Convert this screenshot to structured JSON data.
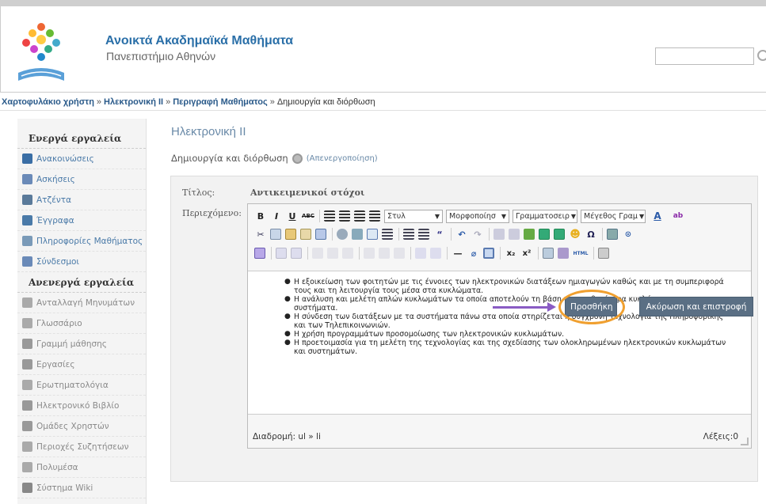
{
  "header": {
    "site_title": "Ανοικτά Ακαδημαϊκά Μαθήματα",
    "site_subtitle": "Πανεπιστήμιο Αθηνών",
    "search_placeholder": ""
  },
  "breadcrumb": {
    "items": [
      "Χαρτοφυλάκιο χρήστη",
      "Ηλεκτρονική ΙΙ",
      "Περιγραφή Μαθήματος"
    ],
    "current": "Δημιουργία και διόρθωση",
    "separator": "»"
  },
  "sidebar": {
    "active_heading": "Ενεργά εργαλεία",
    "active_items": [
      {
        "label": "Ανακοινώσεις",
        "icon": "announcement-icon",
        "color": "#3a6ea5"
      },
      {
        "label": "Ασκήσεις",
        "icon": "exercise-icon",
        "color": "#6a8ab8"
      },
      {
        "label": "Ατζέντα",
        "icon": "calendar-icon",
        "color": "#5a7a9a"
      },
      {
        "label": "Έγγραφα",
        "icon": "folder-icon",
        "color": "#4a7aa8"
      },
      {
        "label": "Πληροφορίες Μαθήματος",
        "icon": "info-icon",
        "color": "#7a9ab8"
      },
      {
        "label": "Σύνδεσμοι",
        "icon": "link-icon",
        "color": "#6a8ab8"
      }
    ],
    "inactive_heading": "Ανενεργά εργαλεία",
    "inactive_items": [
      {
        "label": "Ανταλλαγή Μηνυμάτων",
        "icon": "message-icon",
        "color": "#aaaaaa"
      },
      {
        "label": "Γλωσσάριο",
        "icon": "glossary-icon",
        "color": "#aaaaaa"
      },
      {
        "label": "Γραμμή μάθησης",
        "icon": "learning-path-icon",
        "color": "#999999"
      },
      {
        "label": "Εργασίες",
        "icon": "assignment-icon",
        "color": "#999999"
      },
      {
        "label": "Ερωτηματολόγια",
        "icon": "questionnaire-icon",
        "color": "#aaaaaa"
      },
      {
        "label": "Ηλεκτρονικό Βιβλίο",
        "icon": "ebook-icon",
        "color": "#999999"
      },
      {
        "label": "Ομάδες Χρηστών",
        "icon": "groups-icon",
        "color": "#999999"
      },
      {
        "label": "Περιοχές Συζητήσεων",
        "icon": "forum-icon",
        "color": "#aaaaaa"
      },
      {
        "label": "Πολυμέσα",
        "icon": "multimedia-icon",
        "color": "#aaaaaa"
      },
      {
        "label": "Σύστημα Wiki",
        "icon": "wiki-icon",
        "color": "#888888"
      }
    ]
  },
  "main": {
    "course_title": "Ηλεκτρονική ΙΙ",
    "subtitle": "Δημιουργία και διόρθωση",
    "deactivate_label": "(Απενεργοποίηση)",
    "form": {
      "title_label": "Τίτλος:",
      "title_value": "Αντικειμενικοί στόχοι",
      "content_label": "Περιεχόμενο:"
    },
    "editor": {
      "style_select": "Στυλ",
      "format_select": "Μορφοποίησ",
      "font_select": "Γραμματοσειρ",
      "size_select": "Μέγεθος Γραμ",
      "bullets": [
        "Η εξοικείωση των φοιτητών με τις έννοιες των ηλεκτρονικών διατάξεων ημιαγωγών καθώς και με τη συμπεριφορά τους και τη λειτουργία τους μέσα στα κυκλώματα.",
        "Η ανάλυση και μελέτη απλών κυκλωμάτων τα οποία αποτελούν τη βάση για συνθετότερα κυκλώματα και συστήματα.",
        "Η σύνδεση των διατάξεων με τα συστήματα πάνω στα οποία στηρίζεται η σύγχρονη τεχνολογία της Πληροφορικής και των Τηλεπικοινωνιών.",
        "Η χρήση προγραμμάτων προσομοίωσης των ηλεκτρονικών κυκλωμάτων.",
        "Η προετοιμασία για τη μελέτη της τεχνολογίας και της σχεδίασης των ολοκληρωμένων ηλεκτρονικών κυκλωμάτων και συστημάτων."
      ],
      "path_label": "Διαδρομή: ul » li",
      "word_count": "Λέξεις:0"
    },
    "buttons": {
      "add": "Προσθήκη",
      "cancel": "Ακύρωση και επιστροφή"
    }
  },
  "colors": {
    "accent": "#2a6fa8",
    "button": "#5a6f84",
    "highlight_ring": "#f0a030",
    "arrow": "#8a5cc4"
  }
}
